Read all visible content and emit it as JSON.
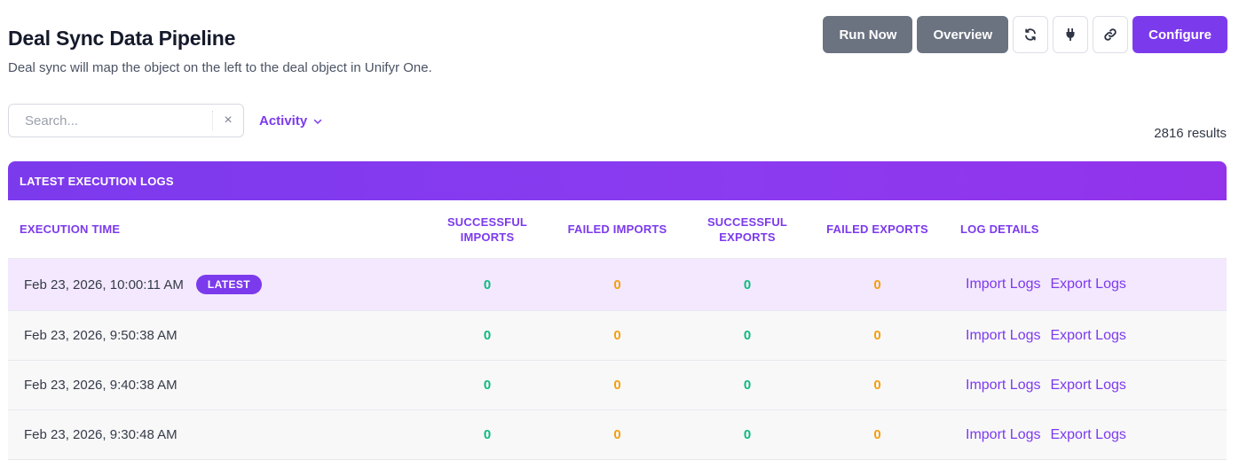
{
  "header": {
    "title": "Deal Sync Data Pipeline",
    "subtitle": "Deal sync will map the object on the left to the deal object in Unifyr One."
  },
  "actions": {
    "run_now": "Run Now",
    "overview": "Overview",
    "configure": "Configure",
    "icons": [
      "refresh-icon",
      "plug-icon",
      "link-icon"
    ]
  },
  "filters": {
    "search_placeholder": "Search...",
    "clear_symbol": "×",
    "activity_label": "Activity",
    "results": "2816 results"
  },
  "table": {
    "banner": "LATEST EXECUTION LOGS",
    "columns": {
      "execution_time": "EXECUTION TIME",
      "successful_imports": "SUCCESSFUL IMPORTS",
      "failed_imports": "FAILED IMPORTS",
      "successful_exports": "SUCCESSFUL EXPORTS",
      "failed_exports": "FAILED EXPORTS",
      "log_details": "LOG DETAILS"
    },
    "latest_badge": "LATEST",
    "import_link": "Import Logs",
    "export_link": "Export Logs",
    "rows": [
      {
        "time": "Feb 23, 2026, 10:00:11 AM",
        "successful_imports": "0",
        "failed_imports": "0",
        "successful_exports": "0",
        "failed_exports": "0"
      },
      {
        "time": "Feb 23, 2026, 9:50:38 AM",
        "successful_imports": "0",
        "failed_imports": "0",
        "successful_exports": "0",
        "failed_exports": "0"
      },
      {
        "time": "Feb 23, 2026, 9:40:38 AM",
        "successful_imports": "0",
        "failed_imports": "0",
        "successful_exports": "0",
        "failed_exports": "0"
      },
      {
        "time": "Feb 23, 2026, 9:30:48 AM",
        "successful_imports": "0",
        "failed_imports": "0",
        "successful_exports": "0",
        "failed_exports": "0"
      }
    ]
  },
  "colors": {
    "accent": "#7c3aed",
    "success": "#10b981",
    "warning": "#f59e0b",
    "neutral_button": "#6b7280"
  }
}
